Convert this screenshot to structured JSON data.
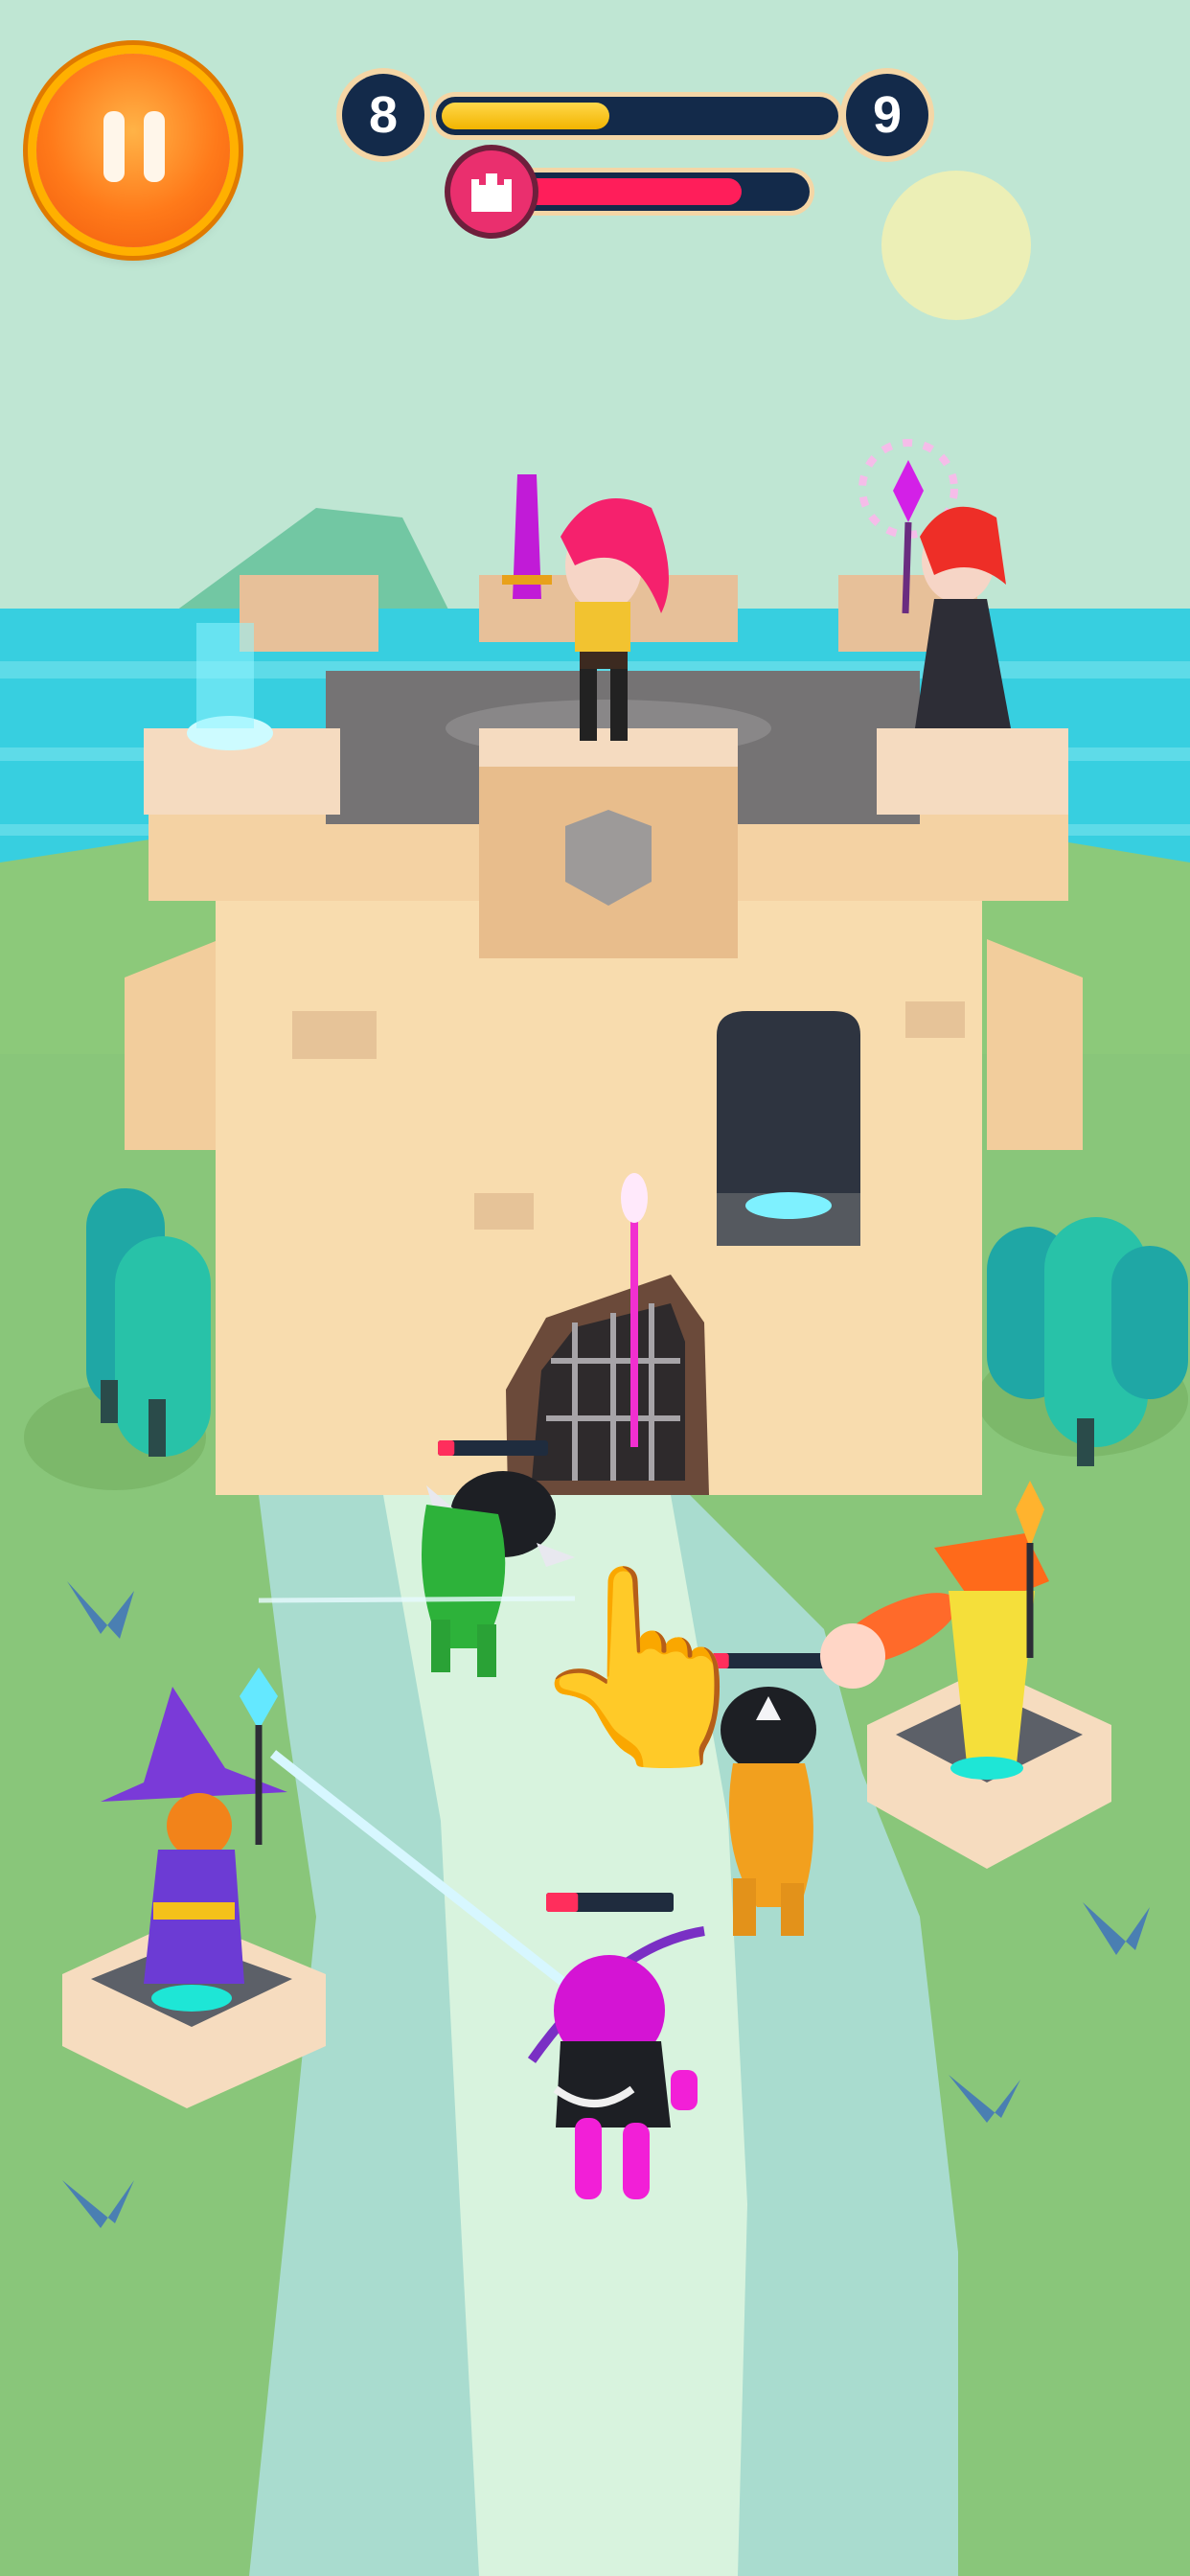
{
  "hud": {
    "current_level": "8",
    "next_level": "9",
    "level_progress": 0.43,
    "castle_health": 0.78,
    "icons": [
      "pause-icon",
      "castle-icon"
    ]
  },
  "scene": {
    "sky_color": "#bfe6d3",
    "sea_color": "#37cfe0",
    "grass_color": "#8cc97a",
    "path_color": "#d8f3de",
    "castle_color": "#f6d7a9",
    "sun_color": "#ecefb6"
  },
  "enemy_health": {
    "green_knight": 0.15,
    "orange_knight": 0.15,
    "pink_archer": 0.25
  },
  "tutorial": {
    "hint_icon": "tap-hand-icon"
  }
}
